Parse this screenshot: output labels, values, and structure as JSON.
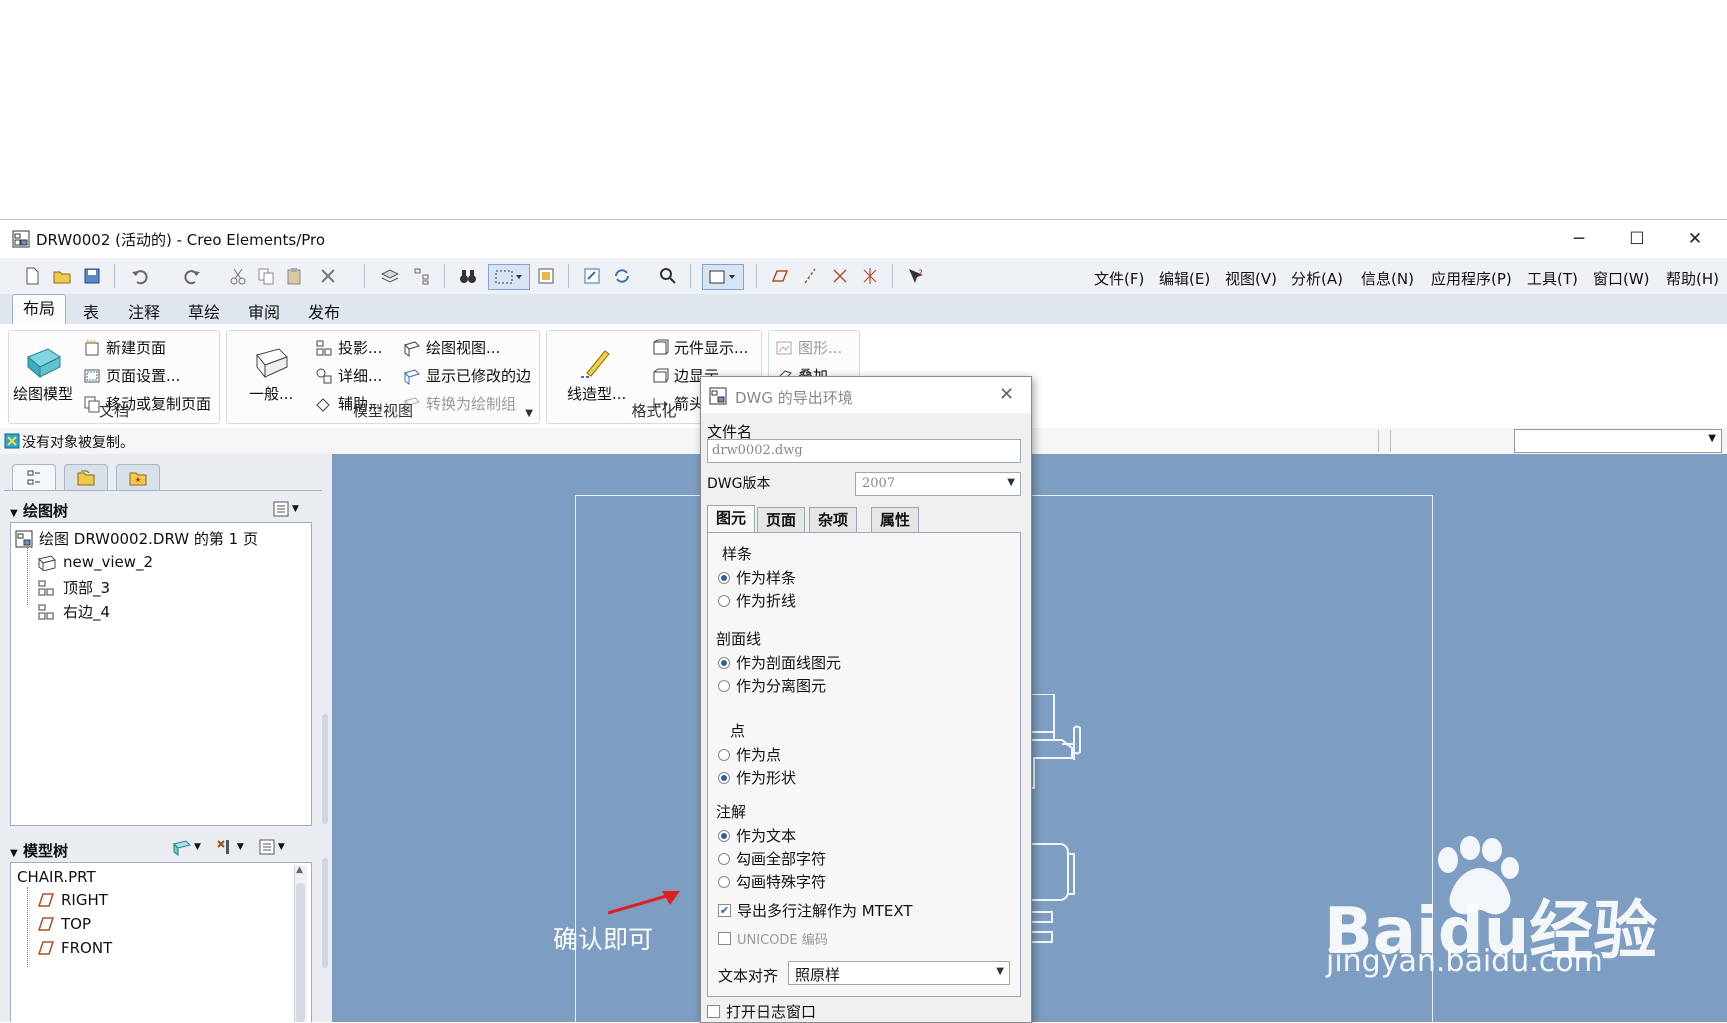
{
  "window": {
    "title": "DRW0002 (活动的) - Creo Elements/Pro",
    "controls": {
      "minimize": "─",
      "maximize": "☐",
      "close": "✕"
    }
  },
  "menubar": [
    "文件(F)",
    "编辑(E)",
    "视图(V)",
    "分析(A)",
    "信息(N)",
    "应用程序(P)",
    "工具(T)",
    "窗口(W)",
    "帮助(H)"
  ],
  "ribbon_tabs": [
    "布局",
    "表",
    "注释",
    "草绘",
    "审阅",
    "发布"
  ],
  "ribbon": {
    "doc_group": {
      "label": "文档",
      "big_button": "绘图模型",
      "items": [
        "新建页面",
        "页面设置...",
        "移动或复制页面"
      ]
    },
    "model_views_group": {
      "label": "模型视图",
      "big_button": "一般...",
      "items": [
        "投影...",
        "详细...",
        "辅助...",
        "绘图视图...",
        "显示已修改的边",
        "转换为绘制组"
      ]
    },
    "format_group": {
      "label": "格式化",
      "big_button": "线造型...",
      "items": [
        "元件显示...",
        "边显示",
        "箭头"
      ]
    },
    "fourth_group": {
      "items": [
        "图形...",
        "叠加"
      ]
    }
  },
  "status": {
    "message": "没有对象被复制。"
  },
  "drawing_tree": {
    "header": "绘图树",
    "root": "绘图 DRW0002.DRW 的第 1 页",
    "children": [
      "new_view_2",
      "顶部_3",
      "右边_4"
    ]
  },
  "model_tree": {
    "header": "模型树",
    "root": "CHAIR.PRT",
    "children": [
      "RIGHT",
      "TOP",
      "FRONT"
    ]
  },
  "dialog": {
    "title": "DWG 的导出环境",
    "filename_label": "文件名",
    "filename_value": "drw0002.dwg",
    "version_label": "DWG版本",
    "version_value": "2007",
    "tabs": [
      "图元",
      "页面",
      "杂项",
      "属性"
    ],
    "sections": {
      "spline": {
        "label": "样条",
        "options": [
          "作为样条",
          "作为折线"
        ],
        "selected": 0
      },
      "hatch": {
        "label": "剖面线",
        "options": [
          "作为剖面线图元",
          "作为分离图元"
        ],
        "selected": 0
      },
      "point": {
        "label": "点",
        "options": [
          "作为点",
          "作为形状"
        ],
        "selected": 1
      },
      "notes": {
        "label": "注解",
        "options": [
          "作为文本",
          "勾画全部字符",
          "勾画特殊字符"
        ],
        "selected": 0
      }
    },
    "mtext_check": "导出多行注解作为 MTEXT",
    "mtext_checked": true,
    "unicode_check": "UNICODE 编码",
    "unicode_checked": false,
    "align_label": "文本对齐",
    "align_value": "照原样",
    "log_check": "打开日志窗口"
  },
  "annotation": {
    "text": "确认即可",
    "color": "#e02020"
  },
  "watermark": {
    "brand": "Baidu经验",
    "url": "jingyan.baidu.com"
  },
  "colors": {
    "canvas": "#7e9dc2",
    "accent": "#2f5f9e"
  }
}
